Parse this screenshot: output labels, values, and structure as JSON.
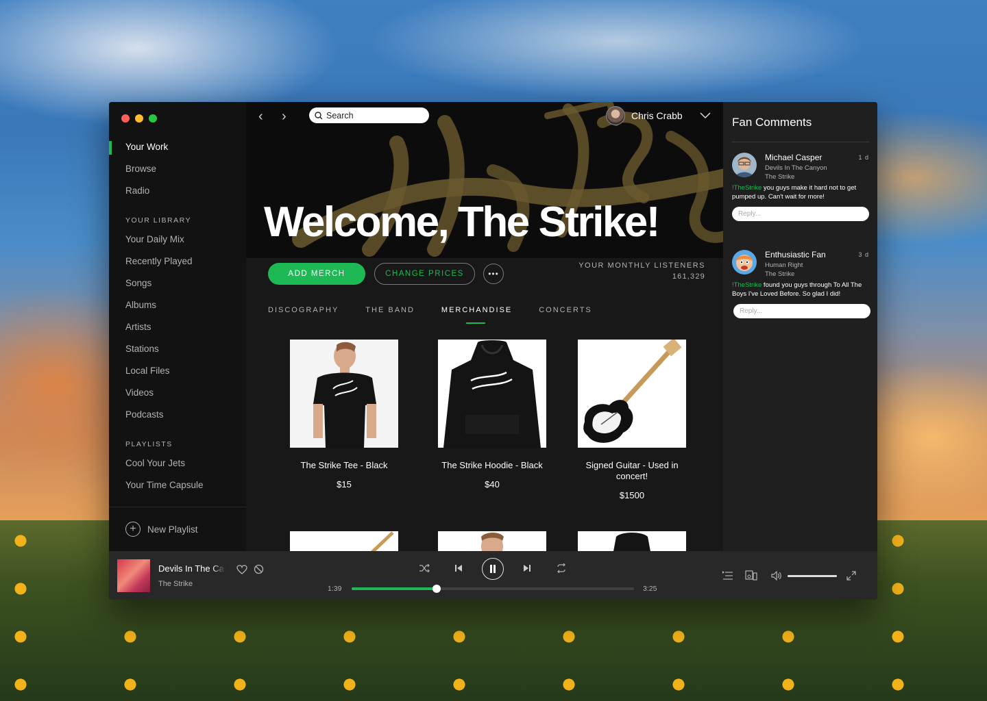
{
  "sidebar": {
    "nav": [
      {
        "label": "Your Work",
        "active": true
      },
      {
        "label": "Browse",
        "active": false
      },
      {
        "label": "Radio",
        "active": false
      }
    ],
    "library_label": "YOUR LIBRARY",
    "library": [
      "Your Daily Mix",
      "Recently Played",
      "Songs",
      "Albums",
      "Artists",
      "Stations",
      "Local Files",
      "Videos",
      "Podcasts"
    ],
    "playlists_label": "PLAYLISTS",
    "playlists": [
      "Cool Your Jets",
      "Your Time Capsule"
    ],
    "new_playlist": "New Playlist"
  },
  "header": {
    "search_placeholder": "Search",
    "user_name": "Chris Crabb",
    "hero_title": "Welcome, The Strike!"
  },
  "actions": {
    "add_merch": "ADD MERCH",
    "change_prices": "CHANGE PRICES",
    "more": "•••",
    "listeners_label": "YOUR MONTHLY LISTENERS",
    "listeners_value": "161,329"
  },
  "tabs": [
    {
      "label": "DISCOGRAPHY",
      "active": false
    },
    {
      "label": "THE BAND",
      "active": false
    },
    {
      "label": "MERCHANDISE",
      "active": true
    },
    {
      "label": "CONCERTS",
      "active": false
    }
  ],
  "merch": [
    {
      "name": "The Strike Tee - Black",
      "price": "$15"
    },
    {
      "name": "The Strike Hoodie - Black",
      "price": "$40"
    },
    {
      "name": "Signed Guitar - Used in concert!",
      "price": "$1500"
    }
  ],
  "comments": {
    "title": "Fan Comments",
    "items": [
      {
        "name": "Michael Casper",
        "time": "1 d",
        "sub1": "Devils In The Canyon",
        "sub2": "The Strike",
        "tag": "!TheStrike",
        "text": " you guys make it hard not to get pumped up. Can't wait for more!",
        "reply_placeholder": "Reply..."
      },
      {
        "name": "Enthusiastic Fan",
        "time": "3 d",
        "sub1": "Human Right",
        "sub2": "The Strike",
        "tag": "!TheStrike",
        "text": " found you guys through To All The Boys I've Loved Before. So glad I did!",
        "reply_placeholder": "Reply..."
      }
    ]
  },
  "player": {
    "track_title": "Devils In The Canyon",
    "artist": "The Strike",
    "elapsed": "1:39",
    "duration": "3:25",
    "progress": 0.3,
    "volume": 1.0
  },
  "colors": {
    "accent": "#1db954",
    "traffic_red": "#ff5f57",
    "traffic_yellow": "#febc2e",
    "traffic_green": "#28c840"
  }
}
